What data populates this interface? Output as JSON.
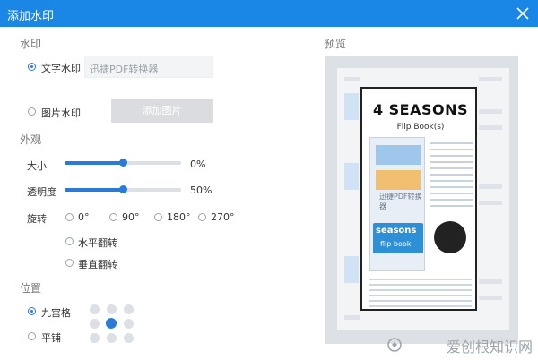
{
  "window": {
    "title": "添加水印"
  },
  "sections": {
    "watermark": "水印",
    "appearance": "外观",
    "position": "位置",
    "preview": "预览"
  },
  "watermark": {
    "text_option_label": "文字水印",
    "text_value": "迅捷PDF转换器",
    "image_option_label": "图片水印",
    "add_image_button": "添加图片",
    "selected": "text"
  },
  "appearance": {
    "size_label": "大小",
    "size_value": "0%",
    "size_level": 0.5,
    "opacity_label": "透明度",
    "opacity_value": "50%",
    "opacity_level": 0.5,
    "rotate_label": "旋转",
    "rotate_options": [
      "0°",
      "90°",
      "180°",
      "270°"
    ],
    "flip_horizontal": "水平翻转",
    "flip_vertical": "垂直翻转"
  },
  "position": {
    "grid_label": "九宫格",
    "tile_label": "平铺",
    "selected": "grid",
    "active_cell": 5
  },
  "preview": {
    "card_title": "4 SEASONS",
    "card_subtitle": "Flip Book(s)",
    "panel_title": "seasons",
    "panel_subtitle": "flip book"
  },
  "brand": {
    "text": "爱创根知识网"
  },
  "colors": {
    "accent": "#2a7ad8",
    "titlebar": "#1a86e6"
  }
}
